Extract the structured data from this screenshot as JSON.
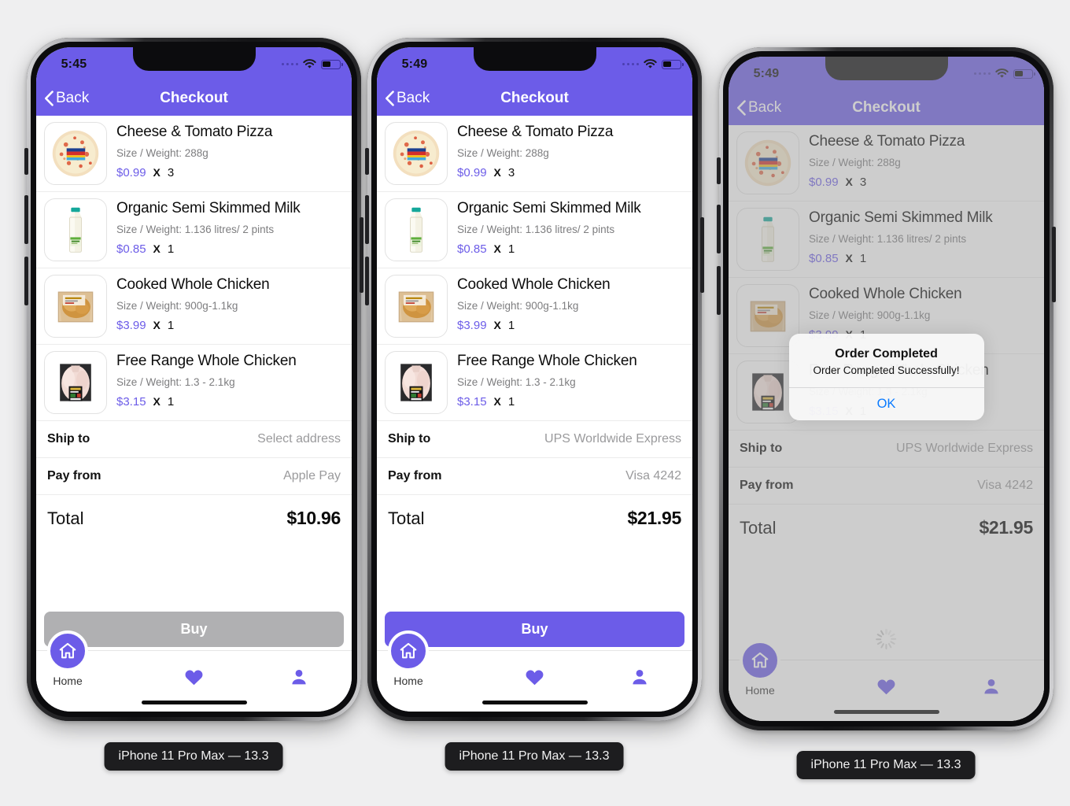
{
  "page": {
    "background_color": "#efeff0",
    "accent_color": "#6c5ce8",
    "link_color": "#0a7bff"
  },
  "common": {
    "nav": {
      "back_label": "Back",
      "title": "Checkout"
    },
    "labels": {
      "ship_to": "Ship to",
      "pay_from": "Pay from",
      "total": "Total",
      "buy": "Buy"
    },
    "tabs": [
      {
        "name": "home",
        "label": "Home",
        "icon": "home-icon"
      },
      {
        "name": "favorites",
        "label": "",
        "icon": "heart-icon"
      },
      {
        "name": "profile",
        "label": "",
        "icon": "person-icon"
      }
    ],
    "cart_items": [
      {
        "name": "Cheese & Tomato Pizza",
        "size": "Size / Weight: 288g",
        "price": "$0.99",
        "multiply": "X",
        "qty": "3",
        "thumb": "pizza-thumbnail"
      },
      {
        "name": "Organic Semi Skimmed Milk",
        "size": "Size / Weight: 1.136 litres/ 2 pints",
        "price": "$0.85",
        "multiply": "X",
        "qty": "1",
        "thumb": "milk-bottle-thumbnail"
      },
      {
        "name": "Cooked Whole Chicken",
        "size": "Size / Weight: 900g-1.1kg",
        "price": "$3.99",
        "multiply": "X",
        "qty": "1",
        "thumb": "cooked-chicken-thumbnail"
      },
      {
        "name": "Free Range Whole Chicken",
        "size": "Size / Weight: 1.3 - 2.1kg",
        "price": "$3.15",
        "multiply": "X",
        "qty": "1",
        "thumb": "raw-chicken-thumbnail"
      }
    ]
  },
  "devices": [
    {
      "id": "phone-1",
      "caption": "iPhone 11 Pro Max — 13.3",
      "status_bar": {
        "time": "5:45",
        "signal": "cellular-dots-icon",
        "wifi": "wifi-icon",
        "battery": "battery-icon"
      },
      "ship_to_value": "Select address",
      "pay_from_value": "Apple Pay",
      "total_value": "$10.96",
      "buy_state": "disabled",
      "dimmed": false,
      "alert": null,
      "loading": false
    },
    {
      "id": "phone-2",
      "caption": "iPhone 11 Pro Max — 13.3",
      "status_bar": {
        "time": "5:49",
        "signal": "cellular-dots-icon",
        "wifi": "wifi-icon",
        "battery": "battery-icon"
      },
      "ship_to_value": "UPS Worldwide Express",
      "pay_from_value": "Visa 4242",
      "total_value": "$21.95",
      "buy_state": "enabled",
      "dimmed": false,
      "alert": null,
      "loading": false
    },
    {
      "id": "phone-3",
      "caption": "iPhone 11 Pro Max — 13.3",
      "status_bar": {
        "time": "5:49",
        "signal": "cellular-dots-icon",
        "wifi": "wifi-icon",
        "battery": "battery-icon"
      },
      "ship_to_value": "UPS Worldwide Express",
      "pay_from_value": "Visa 4242",
      "total_value": "$21.95",
      "buy_state": "hidden",
      "dimmed": true,
      "loading": true,
      "alert": {
        "title": "Order Completed",
        "message": "Order Completed Successfully!",
        "ok_label": "OK"
      }
    }
  ]
}
